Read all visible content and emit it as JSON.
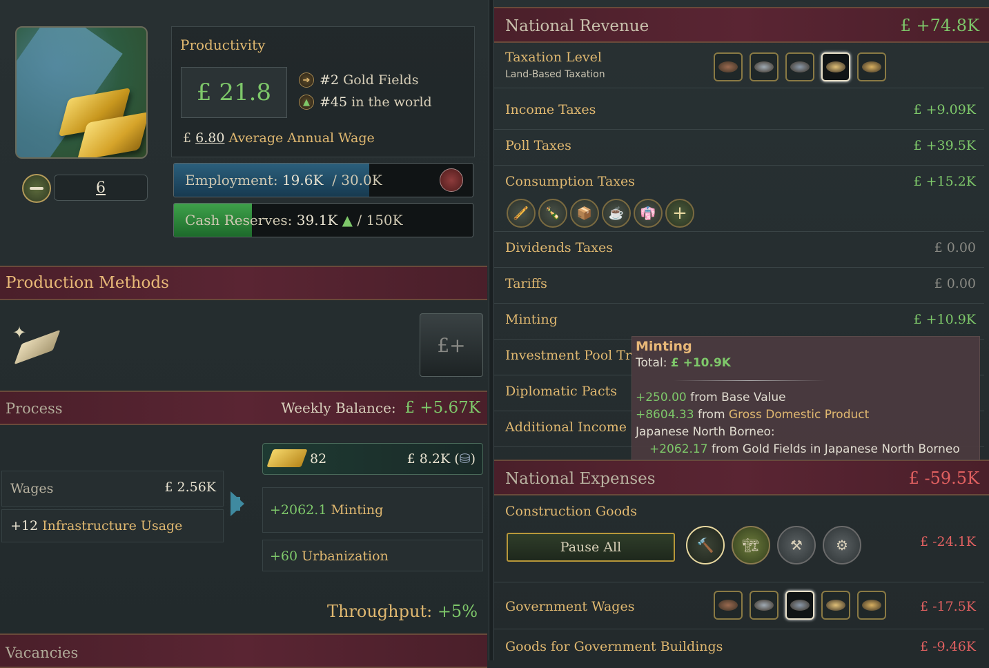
{
  "building": {
    "level": "6",
    "productivity_title": "Productivity",
    "productivity_value": "£ 21.8",
    "rank_domestic": "#2",
    "rank_domestic_label": "Gold Fields",
    "rank_world": "#45",
    "rank_world_label": "in the world",
    "wage_currency": "£",
    "wage_value": "6.80",
    "wage_label": "Average Annual Wage",
    "employment_label": "Employment:",
    "employment_value": "19.6K",
    "employment_max": "/ 30.0K",
    "employment_fraction": 0.653,
    "cash_label": "Cash Reserves:",
    "cash_value": "39.1K",
    "cash_max": "/ 150K",
    "cash_fraction": 0.26
  },
  "production_methods": {
    "title": "Production Methods",
    "button_label": "£+"
  },
  "process": {
    "title": "Process",
    "weekly_label": "Weekly Balance:",
    "weekly_value": "£ +5.67K",
    "wages_label": "Wages",
    "wages_value": "£ 2.56K",
    "infra_amount": "+12",
    "infra_label": "Infrastructure Usage",
    "output_qty": "82",
    "output_value": "£ 8.2K (",
    "output_close": ")",
    "minting_amount": "+2062.1",
    "minting_label": "Minting",
    "urban_amount": "+60",
    "urban_label": "Urbanization",
    "throughput_label": "Throughput:",
    "throughput_value": "+5%",
    "vacancies_title": "Vacancies"
  },
  "revenue": {
    "title": "National Revenue",
    "total": "£ +74.8K",
    "taxation_label": "Taxation Level",
    "taxation_sub": "Land-Based Taxation",
    "taxation_selected_index": 3,
    "rows": [
      {
        "label": "Income Taxes",
        "value": "£ +9.09K",
        "tone": "green"
      },
      {
        "label": "Poll Taxes",
        "value": "£ +39.5K",
        "tone": "green"
      },
      {
        "label": "Consumption Taxes",
        "value": "£ +15.2K",
        "tone": "green"
      },
      {
        "label": "Dividends Taxes",
        "value": "£ 0.00",
        "tone": "grey"
      },
      {
        "label": "Tariffs",
        "value": "£ 0.00",
        "tone": "grey"
      },
      {
        "label": "Minting",
        "value": "£ +10.9K",
        "tone": "green"
      },
      {
        "label": "Investment Pool Trai",
        "value": "",
        "tone": "green"
      },
      {
        "label": "Diplomatic Pacts",
        "value": "",
        "tone": "green"
      },
      {
        "label": "Additional Income",
        "value": "",
        "tone": "green"
      }
    ],
    "consumption_goods": [
      "tobacco-pipe-icon",
      "liquor-icon",
      "opium-icon",
      "tea-icon",
      "fine-clothes-icon"
    ]
  },
  "tooltip": {
    "title": "Minting",
    "total_label": "Total:",
    "total_value": "£ +10.9K",
    "base_value": "+250.00",
    "base_label": "from Base Value",
    "gdp_value": "+8604.33",
    "gdp_from": "from",
    "gdp_label": "Gross Domestic Product",
    "region": "Japanese North Borneo:",
    "gold_value": "+2062.17",
    "gold_label": "from Gold Fields in Japanese North Borneo"
  },
  "expenses": {
    "title": "National Expenses",
    "total": "£ -59.5K",
    "construction_label": "Construction Goods",
    "construction_value": "£ -24.1K",
    "pause_label": "Pause All",
    "gov_wages_label": "Government Wages",
    "gov_wages_value": "£ -17.5K",
    "gov_wages_selected_index": 2,
    "gov_buildings_label": "Goods for Government Buildings",
    "gov_buildings_value": "£ -9.46K"
  },
  "colors": {
    "gold_text": "#e0b870",
    "positive": "#7ec86a",
    "negative": "#e06060",
    "header_band": "#5a2533"
  }
}
